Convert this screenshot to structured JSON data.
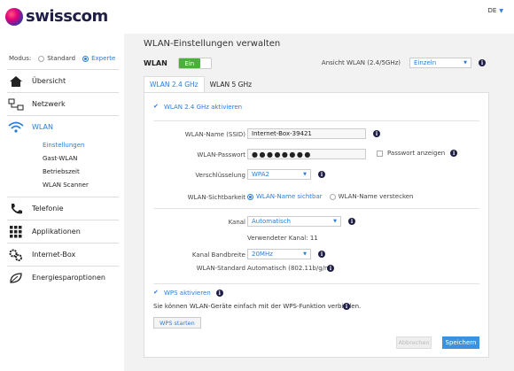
{
  "header": {
    "brand": "swisscom",
    "language": "DE"
  },
  "sidebar": {
    "modus_label": "Modus:",
    "modus_options": [
      "Standard",
      "Experte"
    ],
    "items": [
      {
        "label": "Übersicht",
        "icon": "house-icon"
      },
      {
        "label": "Netzwerk",
        "icon": "network-icon"
      },
      {
        "label": "WLAN",
        "icon": "wifi-icon"
      },
      {
        "label": "Telefonie",
        "icon": "phone-icon"
      },
      {
        "label": "Applikationen",
        "icon": "apps-grid-icon"
      },
      {
        "label": "Internet-Box",
        "icon": "gears-icon"
      },
      {
        "label": "Energiesparoptionen",
        "icon": "leaf-icon"
      }
    ],
    "wlan_sub": [
      "Einstellungen",
      "Gast-WLAN",
      "Betriebszeit",
      "WLAN Scanner"
    ]
  },
  "main": {
    "title": "WLAN-Einstellungen verwalten",
    "wlan_label": "WLAN",
    "toggle_on": "Ein",
    "view_label": "Ansicht WLAN (2.4/5GHz)",
    "view_value": "Einzeln",
    "tabs": [
      "WLAN 2.4 GHz",
      "WLAN 5 GHz"
    ],
    "activate_24": "WLAN 2.4 GHz aktivieren",
    "ssid_label": "WLAN-Name (SSID)",
    "ssid_value": "Internet-Box-39421",
    "pw_label": "WLAN-Passwort",
    "pw_value": "●●●●●●●●",
    "pw_show": "Passwort anzeigen",
    "enc_label": "Verschlüsselung",
    "enc_value": "WPA2",
    "vis_label": "WLAN-Sichtbarkeit",
    "vis_options": [
      "WLAN-Name sichtbar",
      "WLAN-Name verstecken"
    ],
    "channel_label": "Kanal",
    "channel_value": "Automatisch",
    "channel_used": "Verwendeter Kanal: 11",
    "bw_label": "Kanal Bandbreite",
    "bw_value": "20MHz",
    "std_label": "WLAN-Standard",
    "std_value": "Automatisch (802.11b/g/n)",
    "wps_label": "WPS aktivieren",
    "wps_desc": "Sie können WLAN-Geräte einfach mit der WPS-Funktion verbinden.",
    "wps_button": "WPS starten",
    "cancel": "Abbrechen",
    "save": "Speichern"
  }
}
